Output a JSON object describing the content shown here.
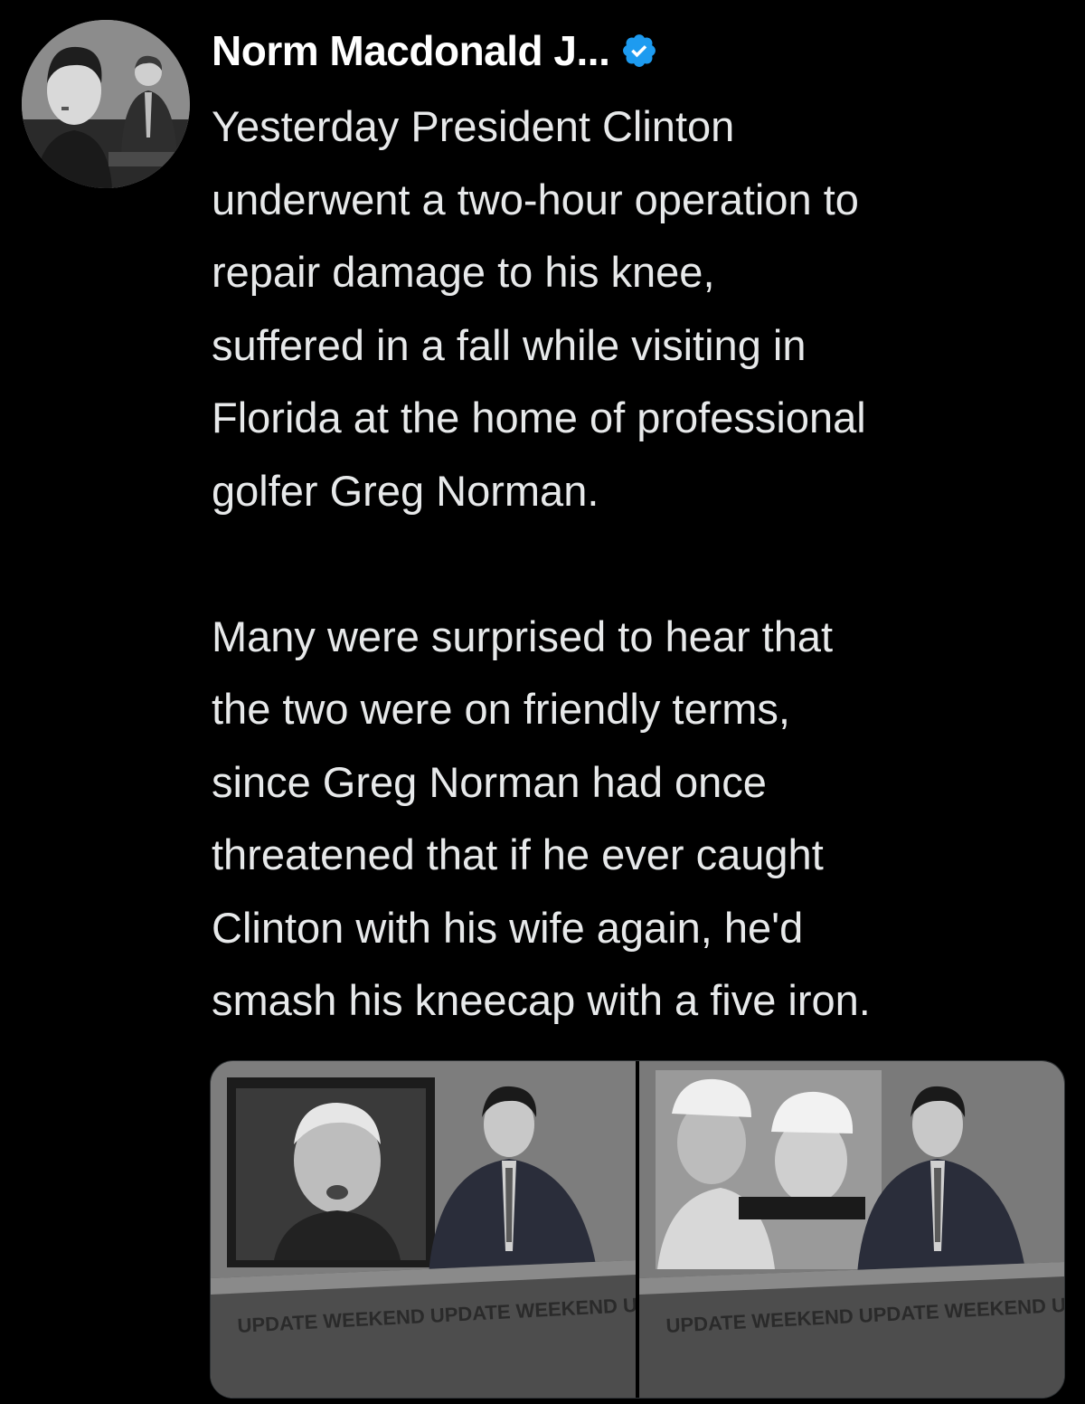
{
  "tweet": {
    "author": {
      "display_name": "Norm Macdonald J...",
      "verified_icon": "verified-badge-icon",
      "verified_color": "#1d9bf0",
      "avatar_icon": "profile-avatar"
    },
    "text": "Yesterday President Clinton\nunderwent a two-hour operation to\nrepair damage to his knee,\nsuffered in a fall while visiting in\nFlorida at the home of professional\ngolfer Greg Norman.\n\nMany were surprised to hear that\nthe two were on friendly terms,\nsince Greg Norman had once\nthreatened that if he ever caught\nClinton with his wife again, he'd\nsmash his kneecap with a five iron.",
    "media": [
      {
        "icon": "news-anchor-clinton-photo",
        "desk_text": "UPDATE WEEKEND UPDATE WEEKEND UPDATE"
      },
      {
        "icon": "news-anchor-golfers-photo",
        "desk_text": "UPDATE WEEKEND UPDATE WEEKEND UPDATE"
      }
    ]
  },
  "colors": {
    "background": "#000000",
    "text": "#e7e9ea",
    "name": "#ffffff",
    "accent": "#1d9bf0"
  }
}
